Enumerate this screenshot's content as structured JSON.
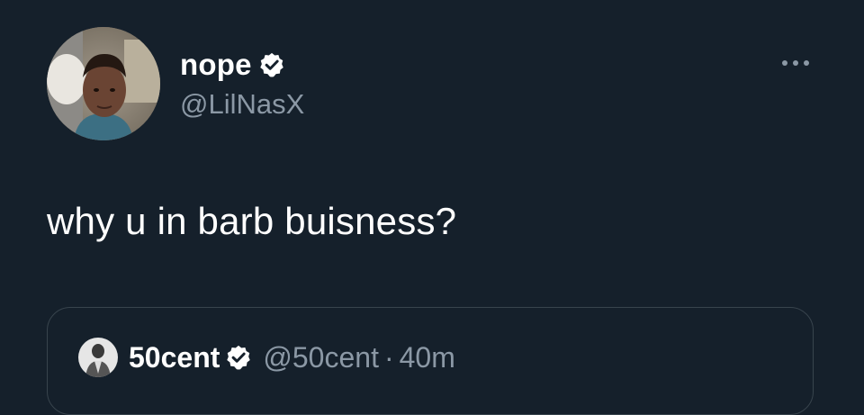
{
  "tweet": {
    "display_name": "nope",
    "handle": "@LilNasX",
    "text": "why u in barb buisness?",
    "avatar_icon": "profile-photo",
    "verified_icon": "verified-badge-icon",
    "more_icon": "more-options-icon"
  },
  "quoted_tweet": {
    "display_name": "50cent",
    "handle": "@50cent",
    "separator": "·",
    "time": "40m",
    "avatar_icon": "profile-photo",
    "verified_icon": "verified-badge-icon"
  },
  "colors": {
    "background": "#15202b",
    "primary_text": "#ffffff",
    "secondary_text": "#8b98a5",
    "card_border": "#38444d"
  }
}
